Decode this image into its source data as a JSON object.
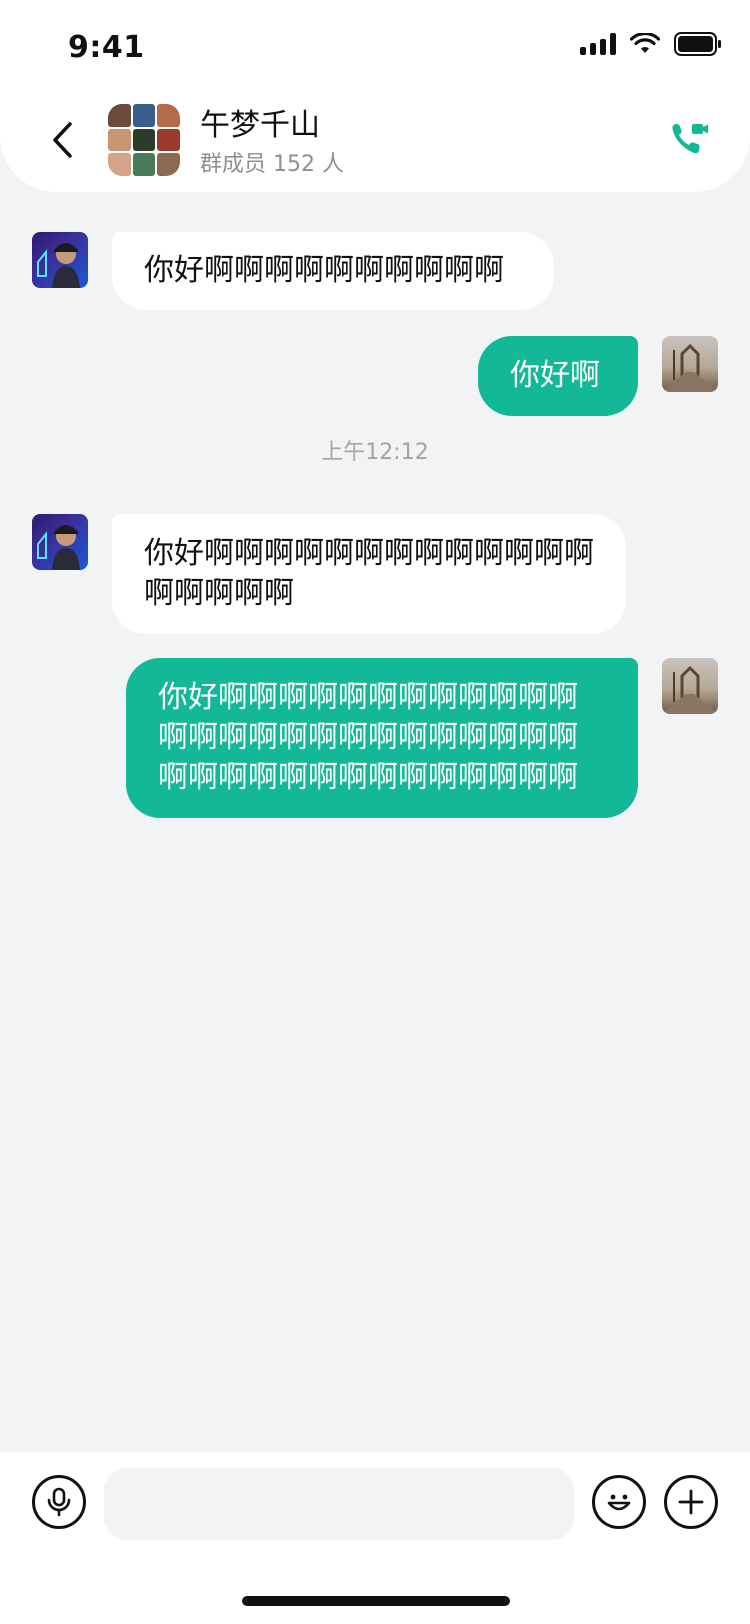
{
  "status_bar": {
    "time": "9:41"
  },
  "header": {
    "title": "午梦千山",
    "subtitle": "群成员 152 人",
    "accent_color": "#13b896",
    "icons": [
      "chevron-left-icon",
      "video-call-icon"
    ]
  },
  "messages": [
    {
      "side": "in",
      "text": "你好啊啊啊啊啊啊啊啊啊啊"
    },
    {
      "side": "out",
      "text": "你好啊"
    },
    {
      "side": "timestamp",
      "text": "上午12:12"
    },
    {
      "side": "in",
      "text": "你好啊啊啊啊啊啊啊啊啊啊啊啊啊啊啊啊啊啊"
    },
    {
      "side": "out",
      "text": "你好啊啊啊啊啊啊啊啊啊啊啊啊啊啊啊啊啊啊啊啊啊啊啊啊啊啊啊啊啊啊啊啊啊啊啊啊啊啊啊啊"
    }
  ],
  "input_bar": {
    "placeholder": "",
    "icons": [
      "microphone-icon",
      "emoji-icon",
      "plus-icon"
    ]
  }
}
